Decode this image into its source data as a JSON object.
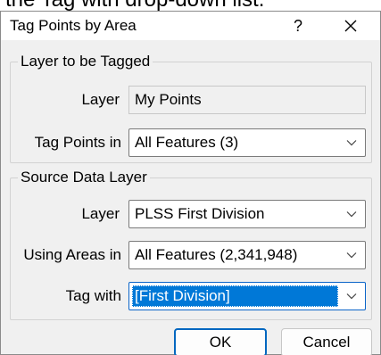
{
  "caption": "the Tag with drop-down list.",
  "window": {
    "title": "Tag Points by Area",
    "help_glyph": "?"
  },
  "layer_group": {
    "title": "Layer to be Tagged",
    "layer_label": "Layer",
    "layer_value": "My Points",
    "tag_points_label": "Tag Points in",
    "tag_points_value": "All Features (3)"
  },
  "source_group": {
    "title": "Source Data Layer",
    "layer_label": "Layer",
    "layer_value": "PLSS First Division",
    "using_areas_label": "Using Areas in",
    "using_areas_value": "All Features (2,341,948)",
    "tag_with_label": "Tag with",
    "tag_with_value": "[First Division]"
  },
  "buttons": {
    "ok": "OK",
    "cancel": "Cancel"
  },
  "icons": {
    "close": "close-icon",
    "dropdown": "chevron-down-icon"
  },
  "colors": {
    "accent": "#0078d7",
    "selection_text": "#ffffff",
    "dialog_bg": "#f0f0f0"
  }
}
